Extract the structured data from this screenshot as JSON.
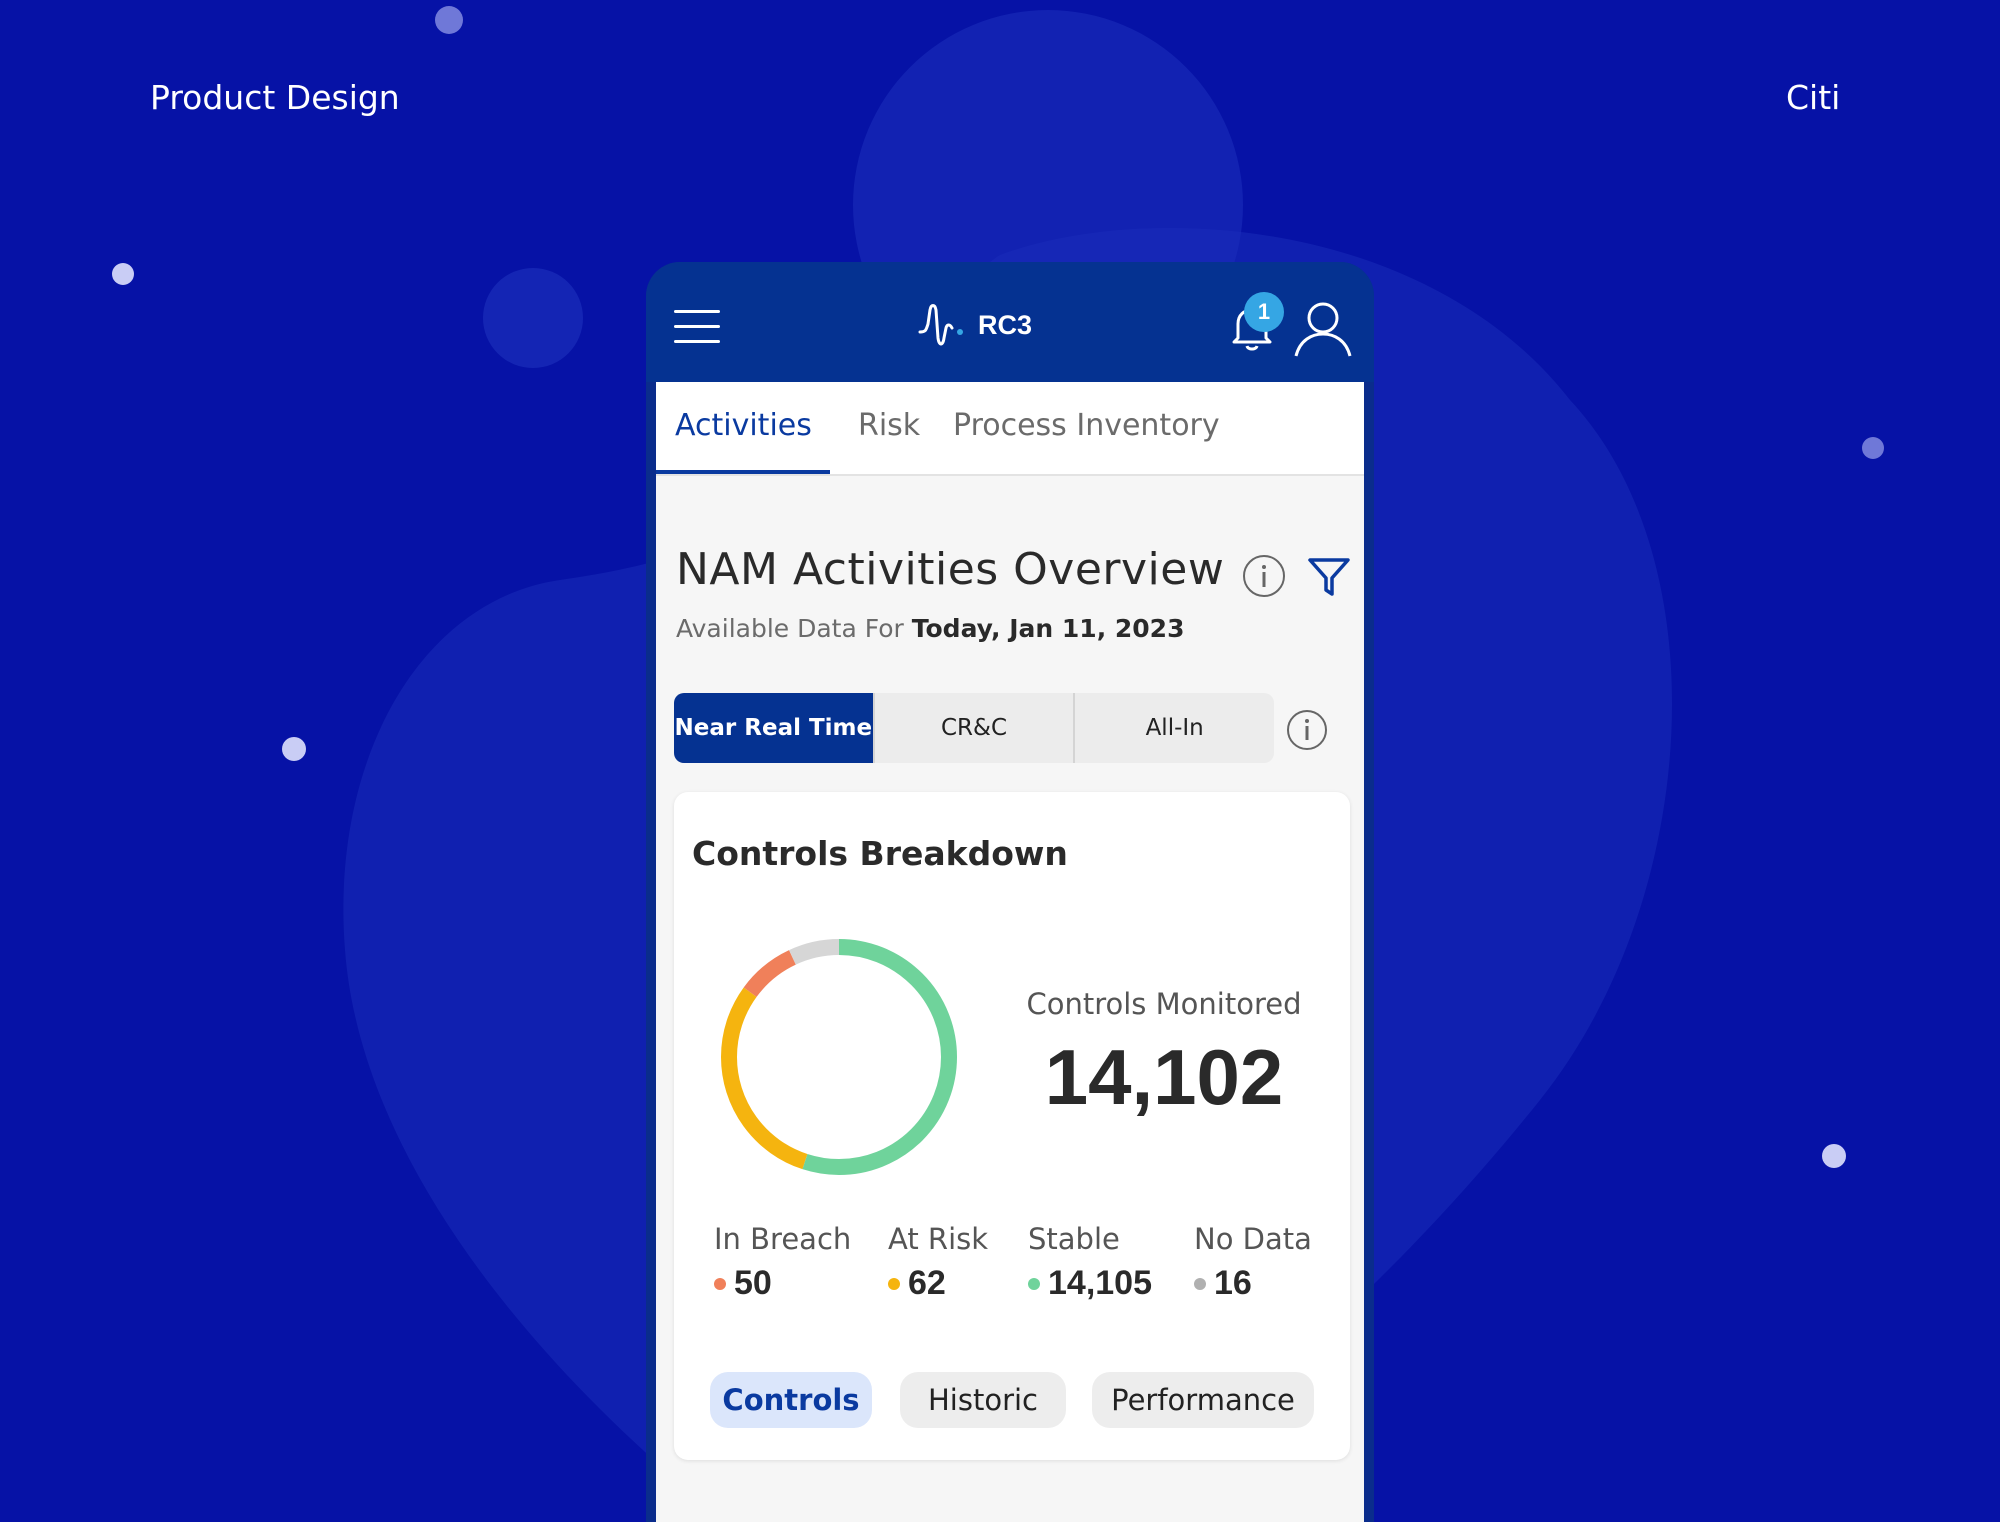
{
  "page": {
    "left_label": "Product Design",
    "right_label": "Citi"
  },
  "app": {
    "brand": "RC3",
    "notification_count": "1",
    "tabs": [
      {
        "label": "Activities",
        "active": true
      },
      {
        "label": "Risk",
        "active": false
      },
      {
        "label": "Process Inventory",
        "active": false
      }
    ],
    "title": "NAM Activities Overview",
    "subtitle_prefix": "Available Data For",
    "subtitle_date": "Today, Jan 11, 2023",
    "segments": [
      {
        "label": "Near Real Time",
        "active": true
      },
      {
        "label": "CR&C",
        "active": false
      },
      {
        "label": "All-In",
        "active": false
      }
    ]
  },
  "card": {
    "title": "Controls Breakdown",
    "monitored_label": "Controls Monitored",
    "monitored_value": "14,102",
    "legend": [
      {
        "label": "In Breach",
        "value": "50",
        "color": "#f0805a"
      },
      {
        "label": "At Risk",
        "value": "62",
        "color": "#f5b40f"
      },
      {
        "label": "Stable",
        "value": "14,105",
        "color": "#6fd39b"
      },
      {
        "label": "No Data",
        "value": "16",
        "color": "#b0b0b0"
      }
    ],
    "donut_segments": [
      {
        "name": "stable",
        "fraction": 0.55,
        "color": "#6fd39b"
      },
      {
        "name": "at-risk",
        "fraction": 0.3,
        "color": "#f5b40f"
      },
      {
        "name": "in-breach",
        "fraction": 0.08,
        "color": "#f0805a"
      },
      {
        "name": "no-data",
        "fraction": 0.07,
        "color": "#d6d6d6"
      }
    ],
    "chips": [
      {
        "label": "Controls",
        "active": true
      },
      {
        "label": "Historic",
        "active": false
      },
      {
        "label": "Performance",
        "active": false
      }
    ]
  },
  "colors": {
    "background": "#0612a6",
    "app_bar": "#053291",
    "accent": "#0a3aa0",
    "badge": "#35a6e4"
  }
}
